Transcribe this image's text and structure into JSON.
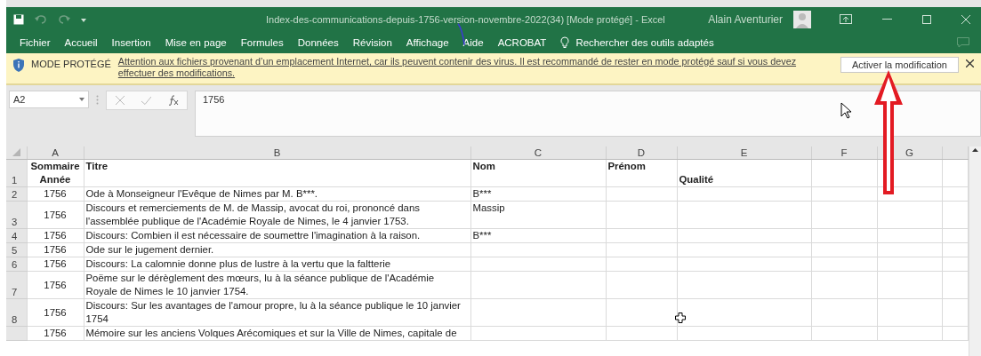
{
  "title_bar": {
    "title": "Index-des-communications-depuis-1756-version-novembre-2022(34)  [Mode protégé]  -  Excel",
    "user": "Alain Aventurier"
  },
  "ribbon": {
    "tabs": [
      "Fichier",
      "Accueil",
      "Insertion",
      "Mise en page",
      "Formules",
      "Données",
      "Révision",
      "Affichage",
      "Aide",
      "ACROBAT"
    ],
    "tell_me": "Rechercher des outils adaptés"
  },
  "protected_bar": {
    "label": "MODE PROTÉGÉ",
    "message": "Attention aux fichiers provenant d’un emplacement Internet, car ils peuvent contenir des virus. Il est recommandé de rester en mode protégé sauf si vous devez effectuer des modifications.",
    "button": "Activer la modification"
  },
  "formula_bar": {
    "name_box": "A2",
    "value": "1756"
  },
  "sheet": {
    "columns": [
      "A",
      "B",
      "C",
      "D",
      "E",
      "F",
      "G"
    ],
    "rows": [
      {
        "number": "1",
        "kind": "header",
        "cells": [
          {
            "text": "SommaireAnnée"
          },
          {
            "text": "Titre"
          },
          {
            "text": "Nom"
          },
          {
            "text": "Prénom"
          },
          {
            "text": "Qualité",
            "bottom_aligned": true
          }
        ]
      },
      {
        "number": "2",
        "kind": "data",
        "cells": [
          {
            "text": "1756"
          },
          {
            "text": "Ode à Monseigneur l'Evêque de Nimes par  M. B***."
          },
          {
            "text": "B***"
          }
        ]
      },
      {
        "number": "3",
        "kind": "data",
        "cells": [
          {
            "text": "1756"
          },
          {
            "text": "Discours et remerciements de M. de Massip, avocat du roi, prononcé dans l'assemblée publique de l'Académie Royale de Nimes, le 4 janvier 1753."
          },
          {
            "text": "Massip"
          }
        ]
      },
      {
        "number": "4",
        "kind": "data",
        "cells": [
          {
            "text": "1756"
          },
          {
            "text": "Discours: Combien il est nécessaire de soumettre l'imagination à la raison."
          },
          {
            "text": "B***"
          }
        ]
      },
      {
        "number": "5",
        "kind": "data",
        "cells": [
          {
            "text": "1756"
          },
          {
            "text": "Ode sur le jugement dernier."
          }
        ]
      },
      {
        "number": "6",
        "kind": "data",
        "cells": [
          {
            "text": "1756"
          },
          {
            "text": "Discours: La calomnie donne plus de lustre à la vertu que la faltterie"
          }
        ]
      },
      {
        "number": "7",
        "kind": "data",
        "cells": [
          {
            "text": "1756"
          },
          {
            "text": "Poëme sur le dérèglement des mœurs, lu à la séance publique de l'Académie Royale de Nimes le 10 janvier 1754."
          }
        ]
      },
      {
        "number": "8",
        "kind": "data",
        "cells": [
          {
            "text": "1756"
          },
          {
            "text": "Discours: Sur les avantages de l'amour propre, lu à la séance publique le 10 janvier 1754"
          }
        ]
      },
      {
        "kind": "data",
        "cells": [
          {
            "text": "1756"
          },
          {
            "text": "Mémoire sur les anciens Volques Arécomiques et sur la Ville de Nimes, capitale de"
          }
        ]
      }
    ]
  }
}
